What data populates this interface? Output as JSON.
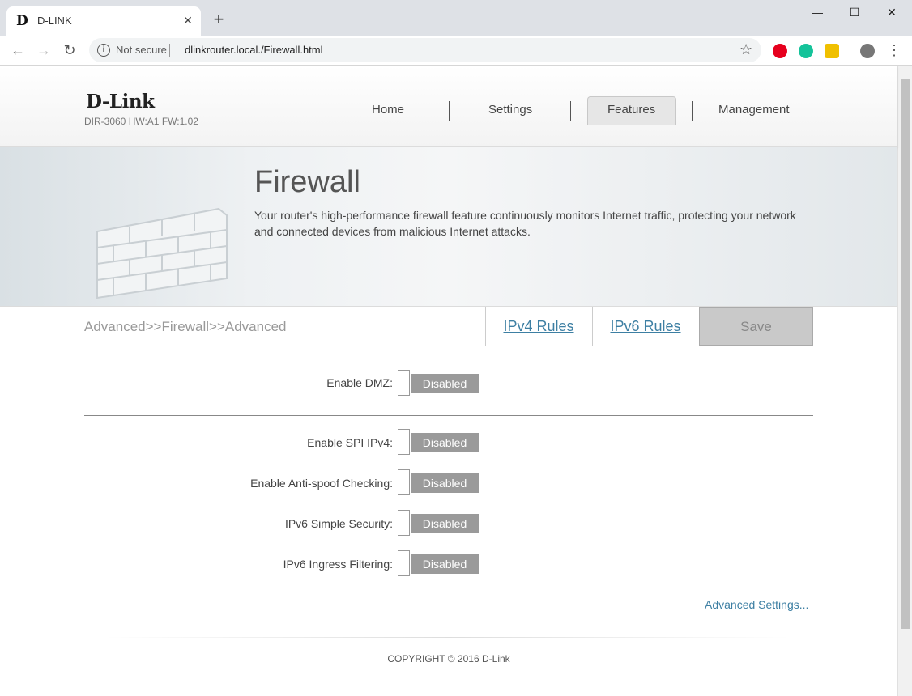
{
  "browser": {
    "tab_title": "D-LINK",
    "tab_favicon": "D",
    "new_tab": "+",
    "security": "Not secure",
    "url": "dlinkrouter.local./Firewall.html"
  },
  "header": {
    "logo": "D-Link",
    "model": "DIR-3060 HW:A1 FW:1.02",
    "nav": [
      "Home",
      "Settings",
      "Features",
      "Management"
    ]
  },
  "banner": {
    "title": "Firewall",
    "description": "Your router's high-performance firewall feature continuously monitors Internet traffic, protecting your network and connected devices from malicious Internet attacks."
  },
  "toolbar": {
    "breadcrumb": "Advanced>>Firewall>>Advanced",
    "ipv4_rules": "IPv4 Rules",
    "ipv6_rules": "IPv6 Rules",
    "save": "Save"
  },
  "settings": {
    "dmz": {
      "label": "Enable DMZ:",
      "value": "Disabled"
    },
    "fields": [
      {
        "label": "Enable SPI IPv4:",
        "value": "Disabled"
      },
      {
        "label": "Enable Anti-spoof Checking:",
        "value": "Disabled"
      },
      {
        "label": "IPv6 Simple Security:",
        "value": "Disabled"
      },
      {
        "label": "IPv6 Ingress Filtering:",
        "value": "Disabled"
      }
    ],
    "advanced_link": "Advanced Settings..."
  },
  "footer": {
    "copyright": "COPYRIGHT © 2016 D-Link"
  },
  "colors": {
    "accent_link": "#3d7fa3",
    "toggle_off": "#9a9a9a",
    "save_disabled": "#c9c9c9"
  }
}
